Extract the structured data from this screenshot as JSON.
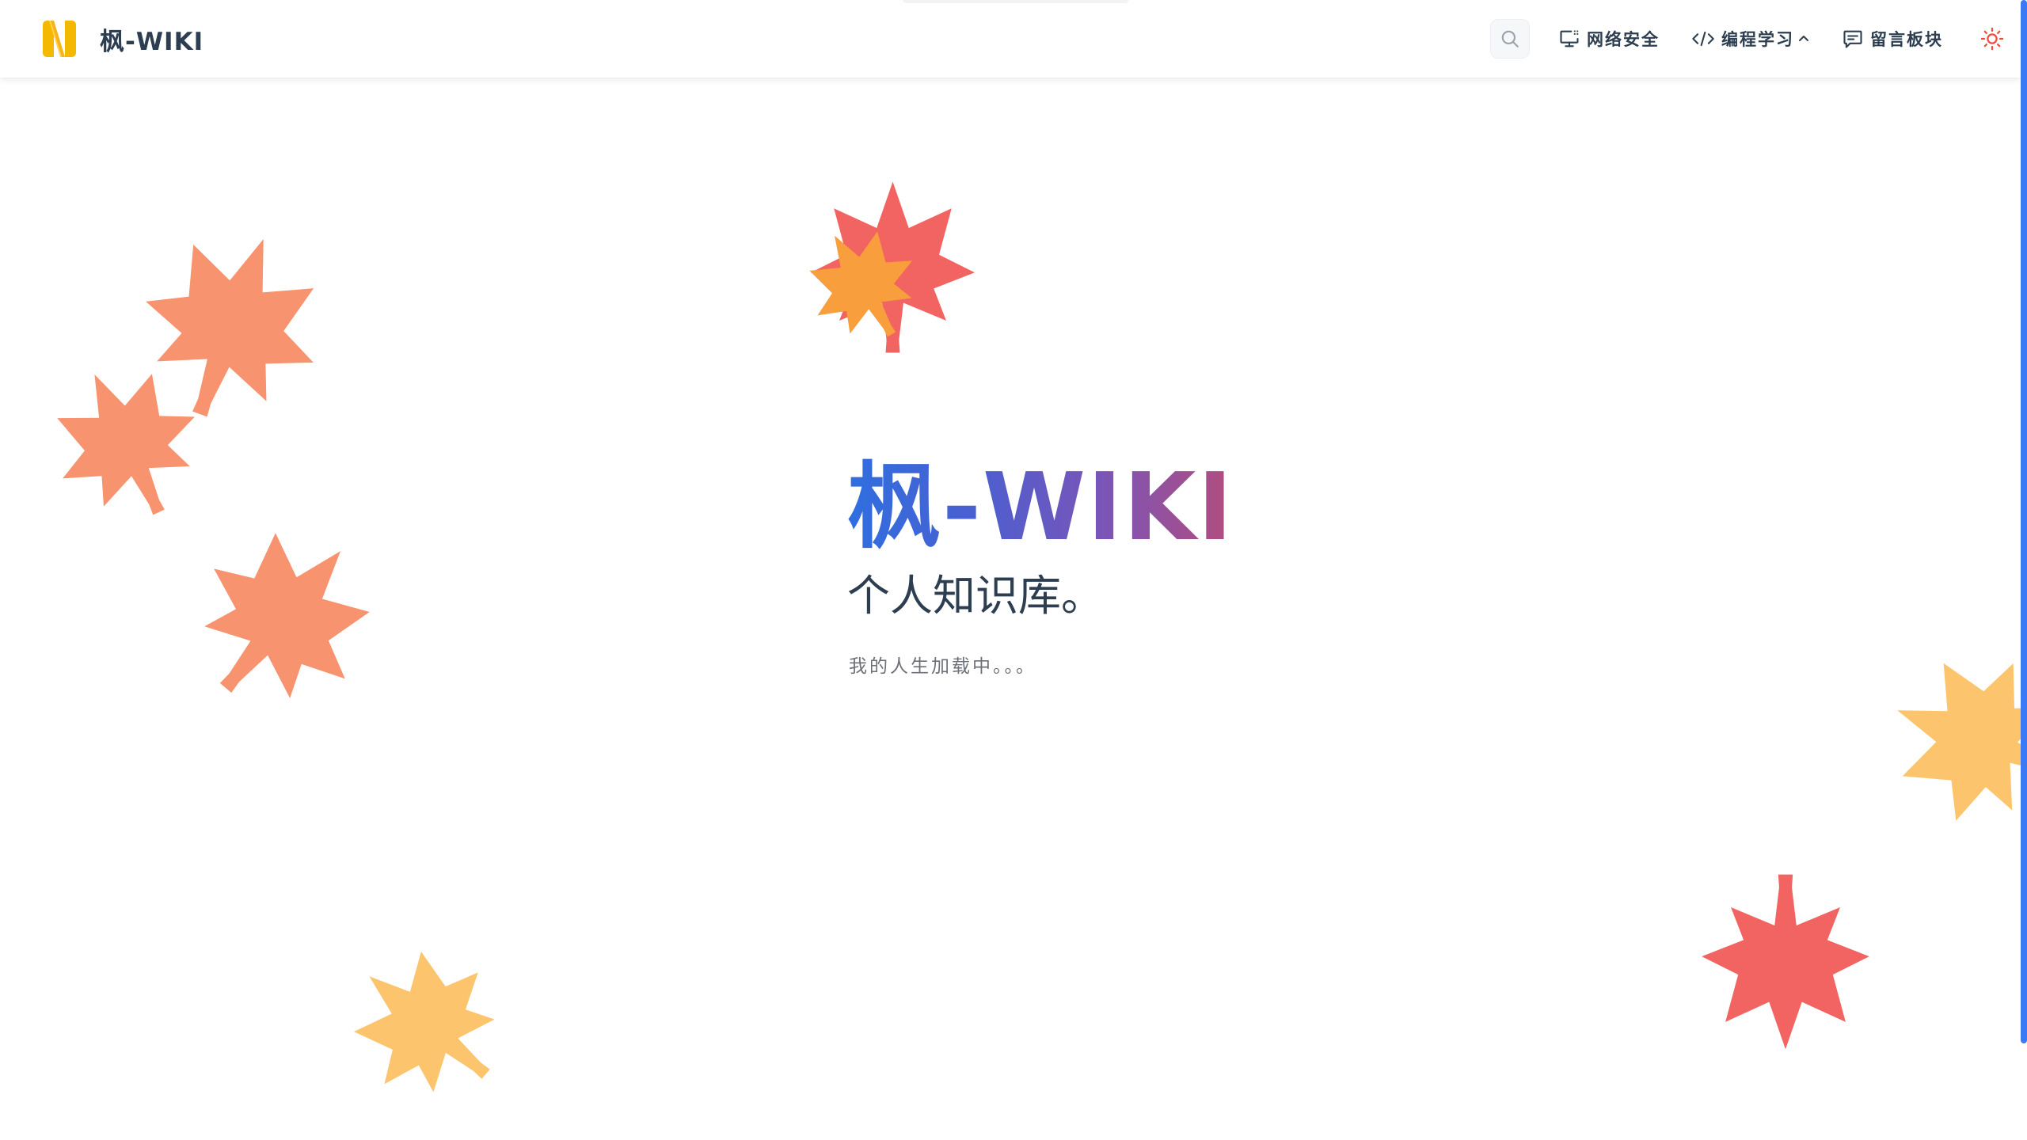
{
  "site": {
    "title": "枫-WIKI",
    "logo_letter": "N"
  },
  "nav": {
    "search_icon": "search-icon",
    "items": [
      {
        "label": "网络安全",
        "icon": "monitor-icon"
      },
      {
        "label": "编程学习",
        "icon": "code-icon",
        "has_dropdown": true,
        "dropdown_icon": "chevron-up-icon"
      },
      {
        "label": "留言板块",
        "icon": "message-icon"
      }
    ],
    "theme_toggle_icon": "sun-icon"
  },
  "hero": {
    "name": "枫-WIKI",
    "text": "个人知识库。",
    "tagline": "我的人生加载中。。。"
  },
  "decorations": {
    "leaf_icon": "maple-leaf-icon",
    "leaf_colors": {
      "orange": "#f7936e",
      "red": "#f26461",
      "amber": "#f99e3c",
      "yellow": "#fcc56d"
    }
  },
  "colors": {
    "accent": "#3a7bf5",
    "gradient_start": "#2f6fe0",
    "gradient_end": "#de3b47",
    "text": "#2c3e50"
  }
}
